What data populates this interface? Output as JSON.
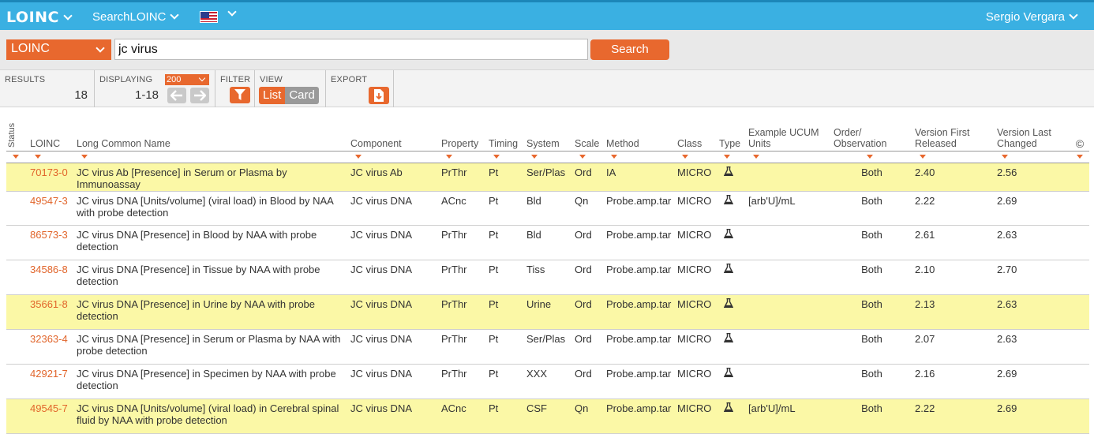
{
  "topbar": {
    "logo": "LOINC",
    "app_menu": "SearchLOINC",
    "user": "Sergio Vergara"
  },
  "search": {
    "code_system": "LOINC",
    "query": "jc virus",
    "button": "Search"
  },
  "controls": {
    "results_label": "RESULTS",
    "results_count": "18",
    "displaying_label": "DISPLAYING",
    "page_size": "200",
    "range": "1-18",
    "filter_label": "FILTER",
    "view_label": "VIEW",
    "view_list": "List",
    "view_card": "Card",
    "export_label": "EXPORT"
  },
  "table": {
    "headers": {
      "status": "Status",
      "loinc": "LOINC",
      "lcn": "Long Common Name",
      "component": "Component",
      "property": "Property",
      "timing": "Timing",
      "system": "System",
      "scale": "Scale",
      "method": "Method",
      "class": "Class",
      "type": "Type",
      "ucum": "Example UCUM Units",
      "order": "Order/ Observation",
      "first": "Version First Released",
      "last": "Version Last Changed",
      "copyright": "©"
    },
    "rows": [
      {
        "code": "70173-0",
        "name": "JC virus Ab [Presence] in Serum or Plasma by Immunoassay",
        "component": "JC virus Ab",
        "property": "PrThr",
        "timing": "Pt",
        "system": "Ser/Plas",
        "scale": "Ord",
        "method": "IA",
        "class": "MICRO",
        "ucum": "",
        "order": "Both",
        "first": "2.40",
        "last": "2.56",
        "highlight": true
      },
      {
        "code": "49547-3",
        "name": "JC virus DNA [Units/volume] (viral load) in Blood by NAA with probe detection",
        "component": "JC virus DNA",
        "property": "ACnc",
        "timing": "Pt",
        "system": "Bld",
        "scale": "Qn",
        "method": "Probe.amp.tar",
        "class": "MICRO",
        "ucum": "[arb'U]/mL",
        "order": "Both",
        "first": "2.22",
        "last": "2.69",
        "highlight": false
      },
      {
        "code": "86573-3",
        "name": "JC virus DNA [Presence] in Blood by NAA with probe detection",
        "component": "JC virus DNA",
        "property": "PrThr",
        "timing": "Pt",
        "system": "Bld",
        "scale": "Ord",
        "method": "Probe.amp.tar",
        "class": "MICRO",
        "ucum": "",
        "order": "Both",
        "first": "2.61",
        "last": "2.63",
        "highlight": false
      },
      {
        "code": "34586-8",
        "name": "JC virus DNA [Presence] in Tissue by NAA with probe detection",
        "component": "JC virus DNA",
        "property": "PrThr",
        "timing": "Pt",
        "system": "Tiss",
        "scale": "Ord",
        "method": "Probe.amp.tar",
        "class": "MICRO",
        "ucum": "",
        "order": "Both",
        "first": "2.10",
        "last": "2.70",
        "highlight": false
      },
      {
        "code": "35661-8",
        "name": "JC virus DNA [Presence] in Urine by NAA with probe detection",
        "component": "JC virus DNA",
        "property": "PrThr",
        "timing": "Pt",
        "system": "Urine",
        "scale": "Ord",
        "method": "Probe.amp.tar",
        "class": "MICRO",
        "ucum": "",
        "order": "Both",
        "first": "2.13",
        "last": "2.63",
        "highlight": true
      },
      {
        "code": "32363-4",
        "name": "JC virus DNA [Presence] in Serum or Plasma by NAA with probe detection",
        "component": "JC virus DNA",
        "property": "PrThr",
        "timing": "Pt",
        "system": "Ser/Plas",
        "scale": "Ord",
        "method": "Probe.amp.tar",
        "class": "MICRO",
        "ucum": "",
        "order": "Both",
        "first": "2.07",
        "last": "2.63",
        "highlight": false
      },
      {
        "code": "42921-7",
        "name": "JC virus DNA [Presence] in Specimen by NAA with probe detection",
        "component": "JC virus DNA",
        "property": "PrThr",
        "timing": "Pt",
        "system": "XXX",
        "scale": "Ord",
        "method": "Probe.amp.tar",
        "class": "MICRO",
        "ucum": "",
        "order": "Both",
        "first": "2.16",
        "last": "2.69",
        "highlight": false
      },
      {
        "code": "49545-7",
        "name": "JC virus DNA [Units/volume] (viral load) in Cerebral spinal fluid by NAA with probe detection",
        "component": "JC virus DNA",
        "property": "ACnc",
        "timing": "Pt",
        "system": "CSF",
        "scale": "Qn",
        "method": "Probe.amp.tar",
        "class": "MICRO",
        "ucum": "[arb'U]/mL",
        "order": "Both",
        "first": "2.22",
        "last": "2.69",
        "highlight": true
      }
    ]
  },
  "colors": {
    "topbar": "#3ab0e2",
    "accent": "#e8682e",
    "highlight_row": "#fbf8a6",
    "code_link": "#e1652b"
  },
  "icons": [
    "chevron-down-icon",
    "us-flag-icon",
    "arrow-left-icon",
    "arrow-right-icon",
    "filter-icon",
    "export-icon",
    "flask-icon",
    "sort-arrow-icon"
  ]
}
